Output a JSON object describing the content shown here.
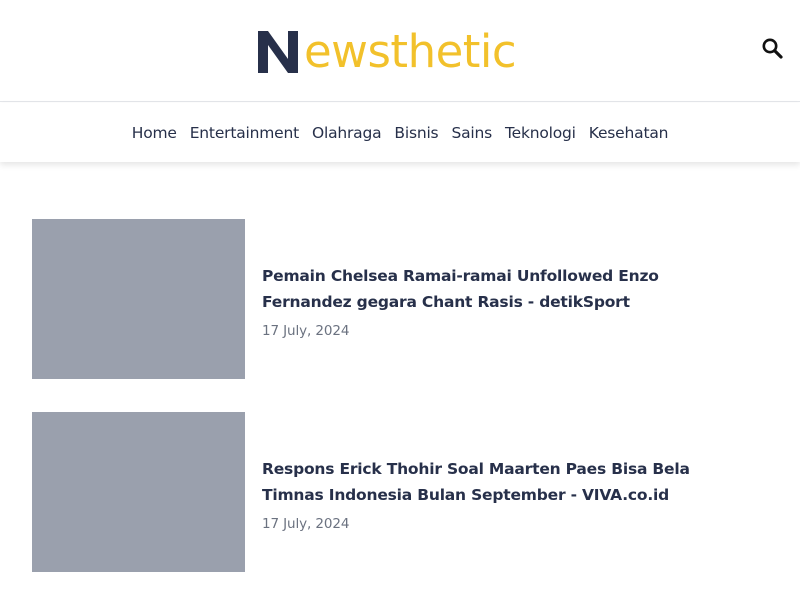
{
  "header": {
    "logo_text": "ewsthetic",
    "logo_mark_icon": "newsthetic-n-logo-icon",
    "search_icon": "search-icon"
  },
  "nav": {
    "items": [
      {
        "label": "Home"
      },
      {
        "label": "Entertainment"
      },
      {
        "label": "Olahraga"
      },
      {
        "label": "Bisnis"
      },
      {
        "label": "Sains"
      },
      {
        "label": "Teknologi"
      },
      {
        "label": "Kesehatan"
      }
    ]
  },
  "articles": [
    {
      "title": "Pemain Chelsea Ramai-ramai Unfollowed Enzo Fernandez gegara Chant Rasis - detikSport",
      "date": "17 July, 2024"
    },
    {
      "title": "Respons Erick Thohir Soal Maarten Paes Bisa Bela Timnas Indonesia Bulan September - VIVA.co.id",
      "date": "17 July, 2024"
    }
  ],
  "colors": {
    "brand_yellow": "#f2c12b",
    "brand_navy": "#27304a",
    "thumbnail_placeholder": "#9aa0ad",
    "date_gray": "#6b7280"
  }
}
